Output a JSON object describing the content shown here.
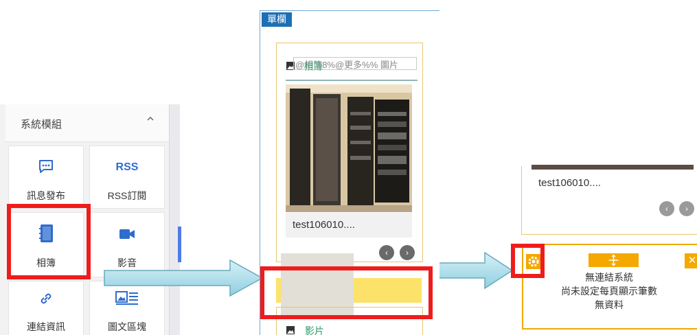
{
  "palette": {
    "title": "系統模組",
    "tiles": [
      {
        "label": "訊息發布",
        "icon": "message-icon"
      },
      {
        "label": "RSS訂閱",
        "icon_text": "RSS"
      },
      {
        "label": "相簿",
        "icon": "album-icon"
      },
      {
        "label": "影音",
        "icon": "video-icon"
      },
      {
        "label": "連結資訊",
        "icon": "link-icon"
      },
      {
        "label": "圖文區塊",
        "icon": "image-text-icon"
      }
    ]
  },
  "layout": {
    "tag": "單欄",
    "album_header": "@相簿8%@更多%% 圖片",
    "album_overlay": "相簿",
    "album_caption": "test106010....",
    "video_label": "影片"
  },
  "result": {
    "album_caption": "test106010....",
    "lines": [
      "無連結系統",
      "尚未設定每頁顯示筆數",
      "無資料"
    ]
  },
  "colors": {
    "highlight_red": "#ef1c1c",
    "accent_orange": "#f5a800",
    "drop_yellow": "#fde26a",
    "tag_blue": "#1e6fb3",
    "icon_blue": "#2f6ccd"
  }
}
